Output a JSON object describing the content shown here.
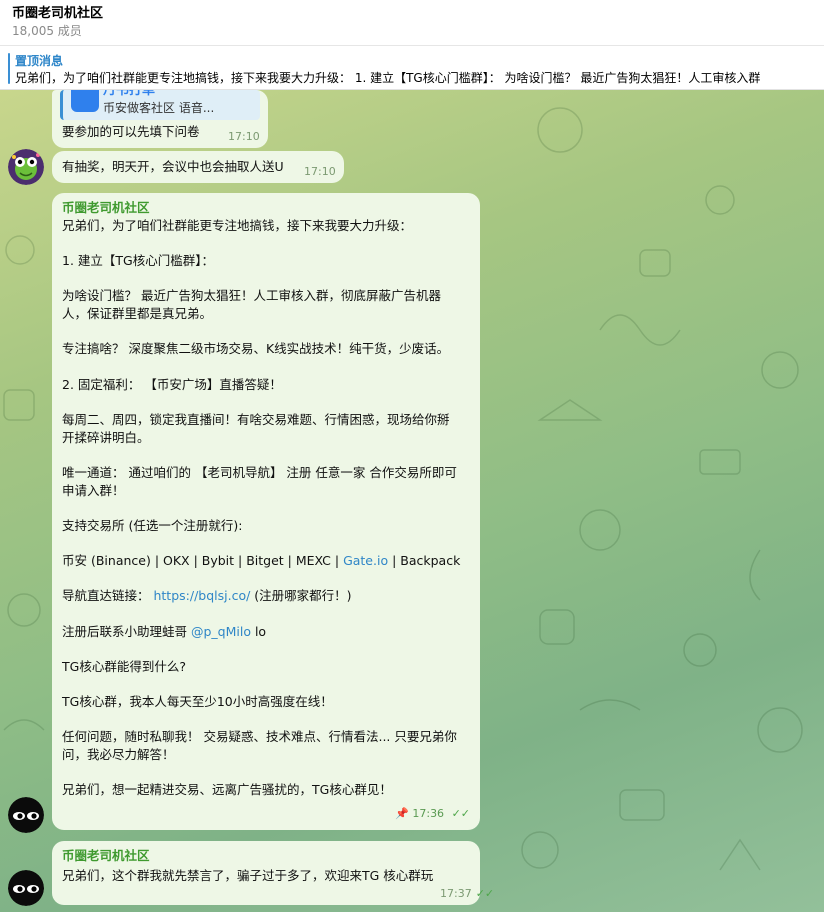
{
  "header": {
    "title": "币圈老司机社区",
    "members": "18,005 成员"
  },
  "pinned": {
    "label": "置顶消息",
    "text": "兄弟们，为了咱们社群能更专注地搞钱，接下来我要大力升级： 1. 建立【TG核心门槛群】： 为啥设门槛？ 最近广告狗太猖狂！人工审核入群"
  },
  "messages": [
    {
      "card_head": "丹书打单",
      "card_body": "币安做客社区 语音...",
      "text": "要参加的可以先填下问卷",
      "time": "17:10"
    },
    {
      "text": "有抽奖，明天开，会议中也会抽取人送U",
      "time": "17:10"
    },
    {
      "sender": "币圈老司机社区",
      "paragraphs": [
        "兄弟们，为了咱们社群能更专注地搞钱，接下来我要大力升级：",
        "",
        "1. 建立【TG核心门槛群】：",
        "",
        "为啥设门槛？ 最近广告狗太猖狂！人工审核入群，彻底屏蔽广告机器",
        "人，保证群里都是真兄弟。",
        "",
        "专注搞啥？ 深度聚焦二级市场交易、K线实战技术！纯干货，少废话。",
        "",
        "2. 固定福利： 【币安广场】直播答疑！",
        "",
        "每周二、周四，锁定我直播间！有啥交易难题、行情困惑，现场给你掰",
        "开揉碎讲明白。",
        "",
        "唯一通道： 通过咱们的 【老司机导航】 注册 任意一家 合作交易所即可",
        "申请入群！",
        "",
        "支持交易所 (任选一个注册就行):",
        "",
        "币安 (Binance) | OKX | Bybit | Bitget | MEXC | ",
        "",
        "导航直达链接： ",
        "",
        "注册后联系小助理蛙哥 ",
        "",
        "TG核心群能得到什么?",
        "",
        "TG核心群，我本人每天至少10小时高强度在线！",
        "",
        "任何问题，随时私聊我！ 交易疑惑、技术难点、行情看法... 只要兄弟你",
        "问，我必尽力解答！",
        "",
        "兄弟们，想一起精进交易、远离广告骚扰的，TG核心群见！"
      ],
      "exchanges_link": "Gate.io",
      "exchanges_tail": " | Backpack",
      "nav_link": "https://bqlsj.co/",
      "nav_tail": " (注册哪家都行！)",
      "assistant_link": "@p_qMilo",
      "assistant_tail": " lo",
      "time": "17:36"
    },
    {
      "sender": "币圈老司机社区",
      "text": "兄弟们，这个群我就先禁言了，骗子过于多了，欢迎来TG 核心群玩",
      "time": "17:37"
    }
  ],
  "colors": {
    "accent": "#2f86c7",
    "sender": "#3f9a2f",
    "bubble": "#eef7e6"
  }
}
